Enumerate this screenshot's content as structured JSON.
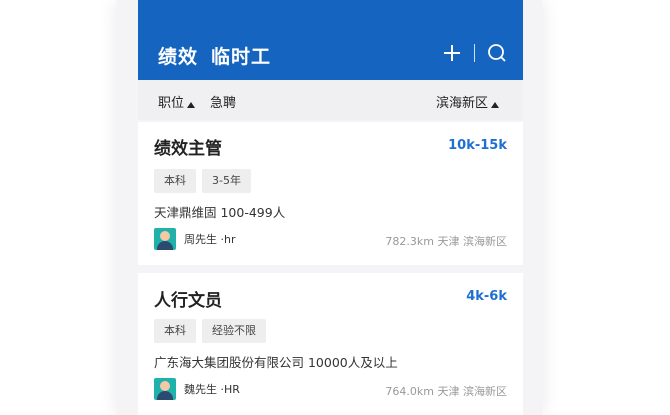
{
  "header": {
    "tabs": [
      "绩效",
      "临时工"
    ],
    "icons": [
      "plus-icon",
      "search-icon"
    ]
  },
  "filters": {
    "position_label": "职位",
    "tag_label": "急聘",
    "area_label": "滨海新区"
  },
  "jobs": [
    {
      "title": "绩效主管",
      "salary": "10k-15k",
      "tags": [
        "本科",
        "3-5年"
      ],
      "company": "天津鼎维固 100-499人",
      "recruiter": "周先生 ·hr",
      "location": "782.3km 天津 滨海新区"
    },
    {
      "title": "人行文员",
      "salary": "4k-6k",
      "tags": [
        "本科",
        "经验不限"
      ],
      "company": "广东海大集团股份有限公司 10000人及以上",
      "recruiter": "魏先生 ·HR",
      "location": "764.0km 天津 滨海新区"
    }
  ],
  "colors": {
    "primary": "#1565c0",
    "salary": "#1e6fd1",
    "background": "#f4f4f6"
  }
}
